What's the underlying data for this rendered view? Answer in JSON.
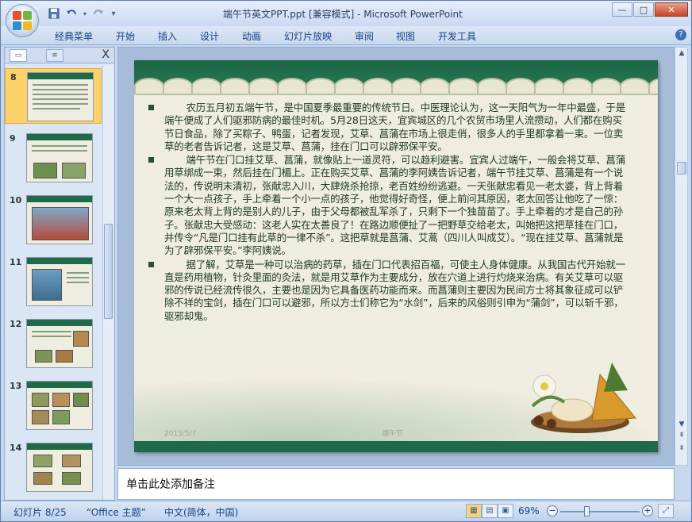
{
  "window": {
    "title": "端午节英文PPT.ppt [兼容模式] - Microsoft PowerPoint",
    "controls": {
      "minimize": "—",
      "maximize": "□",
      "close": "✕"
    }
  },
  "qat": {
    "save_icon": "save-icon",
    "undo_icon": "undo-icon",
    "redo_icon": "redo-icon",
    "customize": "▾"
  },
  "ribbon": {
    "tabs": [
      "经典菜单",
      "开始",
      "插入",
      "设计",
      "动画",
      "幻灯片放映",
      "审阅",
      "视图",
      "开发工具"
    ],
    "help": "?"
  },
  "left_pane": {
    "close": "X",
    "slides": [
      "8",
      "9",
      "10",
      "11",
      "12",
      "13",
      "14"
    ],
    "selected": "8"
  },
  "slide": {
    "paragraphs": [
      "农历五月初五端午节，是中国夏季最重要的传统节日。中医理论认为，这一天阳气为一年中最盛，于是端午便成了人们驱邪防病的最佳时机。5月28日这天，宜宾城区的几个农贸市场里人流攒动，人们都在购买节日食品，除了买粽子、鸭蛋，记者发现，艾草、菖蒲在市场上很走俏，很多人的手里都拿着一束。一位卖草的老者告诉记者，这是艾草、菖蒲，挂在门口可以辟邪保平安。",
      "端午节在门口挂艾草、菖蒲，就像贴上一道灵符，可以趋利避害。宜宾人过端午，一般会将艾草、菖蒲用草绑成一束，然后挂在门楣上。正在购买艾草、菖蒲的李阿姨告诉记者，端午节挂艾草、菖蒲是有一个说法的，传说明末清初，张献忠入川，大肆烧杀抢掠，老百姓纷纷逃避。一天张献忠看见一老太婆，背上背着一个大一点孩子，手上牵着一个小一点的孩子，他觉得好奇怪，便上前问其原因，老太回答让他吃了一惊：原来老太背上背的是别人的儿子，由于父母都被乱军杀了，只剩下一个独苗苗了。手上牵着的才是自己的孙子。张献忠大受感动：这老人实在太善良了！在路边顺便扯了一把野草交给老太，叫她把这把草挂在门口，并传令“凡是门口挂有此草的一律不杀”。这把草就是菖蒲、艾蒿（四川人叫成艾）。“现在挂艾草、菖蒲就是为了辟邪保平安。”李阿姨说。",
      "据了解，艾草是一种可以治病的药草，插在门口代表招百福，可使主人身体健康。从我国古代开始就一直是药用植物，针灸里面的灸法，就是用艾草作为主要成分，放在穴道上进行灼烧来治病。有关艾草可以驱邪的传说已经流传很久，主要也是因为它具备医药功能而来。而菖蒲则主要因为民间方士将其象征成可以铲除不祥的宝剑，插在门口可以避邪，所以方士们称它为“水剑”，后来的风俗则引申为“蒲剑”，可以斩千邪，驱邪却鬼。"
    ],
    "date": "2015/5/7",
    "footer": "端午节"
  },
  "notes": {
    "placeholder": "单击此处添加备注"
  },
  "status": {
    "slide_info": "幻灯片 8/25",
    "theme": "“Office 主题”",
    "language": "中文(简体，中国)",
    "zoom": "69%",
    "zoom_level": 0.69
  },
  "colors": {
    "accent_green": "#1f6a48",
    "selected_thumb": "#fbd36a",
    "ribbon_text": "#15428b"
  }
}
